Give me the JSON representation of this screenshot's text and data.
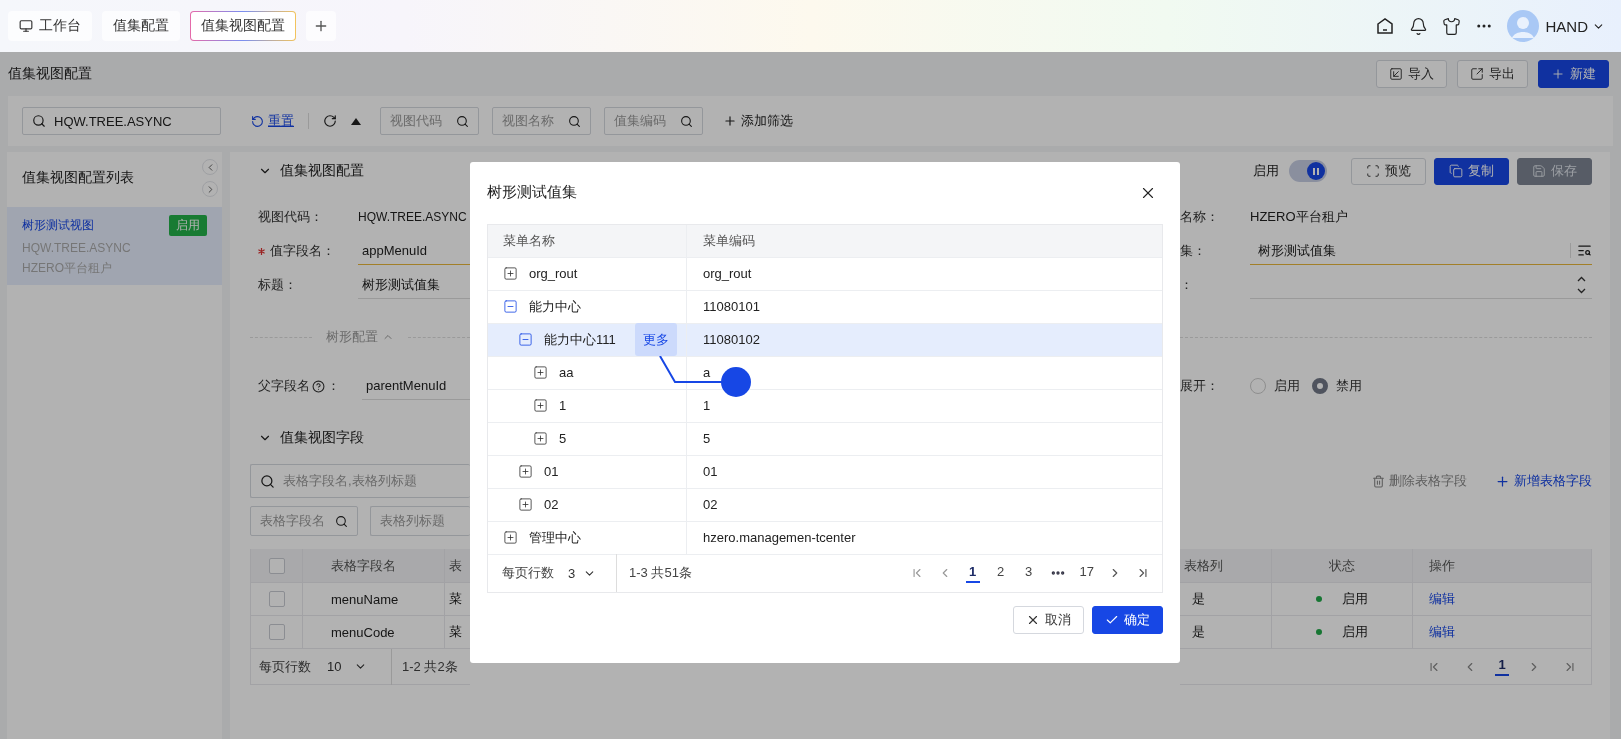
{
  "topbar": {
    "tabs": [
      {
        "label": "工作台",
        "kind": "home",
        "selected": false
      },
      {
        "label": "值集配置",
        "kind": "plain",
        "selected": false
      },
      {
        "label": "值集视图配置",
        "kind": "plain",
        "selected": true
      }
    ],
    "user": "HAND"
  },
  "page": {
    "title": "值集视图配置",
    "actions": [
      {
        "label": "导入",
        "kind": "import"
      },
      {
        "label": "导出",
        "kind": "export"
      },
      {
        "label": "新建",
        "kind": "create"
      }
    ]
  },
  "filter": {
    "search_value": "HQW.TREE.ASYNC",
    "reset": "重置",
    "fields": [
      {
        "placeholder": "视图代码"
      },
      {
        "placeholder": "视图名称"
      },
      {
        "placeholder": "值集编码"
      }
    ],
    "add_filter": "添加筛选"
  },
  "sidebar": {
    "title": "值集视图配置列表",
    "items": [
      {
        "name": "树形测试视图",
        "tag": "启用",
        "code": "HQW.TREE.ASYNC",
        "tenant": "HZERO平台租户",
        "selected": true
      }
    ]
  },
  "detail": {
    "section_title": "值集视图配置",
    "enabled_label": "启用",
    "enabled_on": true,
    "buttons": [
      {
        "label": "预览",
        "kind": "preview"
      },
      {
        "label": "复制",
        "kind": "copy"
      },
      {
        "label": "保存",
        "kind": "save",
        "disabled": true
      }
    ],
    "left_fields": [
      {
        "label": "视图代码：",
        "value": "HQW.TREE.ASYNC",
        "kind": "text"
      },
      {
        "label": "值字段名：",
        "value": "appMenuId",
        "kind": "input",
        "required": true
      },
      {
        "label": "标题：",
        "value": "树形测试值集",
        "kind": "input",
        "required": false
      }
    ],
    "right_fields": [
      {
        "label": "名称：",
        "value": "HZERO平台租户",
        "kind": "text"
      },
      {
        "label": "集：",
        "value": "树形测试值集",
        "kind": "lookup",
        "required": true
      },
      {
        "label": "：",
        "kind": "number",
        "required": false
      }
    ],
    "tree_divider": "树形配置",
    "parent_field": {
      "label": "父字段名",
      "colon": "：",
      "value": "parentMenuId"
    },
    "expand": {
      "label": "展开：",
      "options": [
        {
          "label": "启用",
          "selected": false
        },
        {
          "label": "禁用",
          "selected": true
        }
      ]
    }
  },
  "fields_section": {
    "title": "值集视图字段",
    "search_placeholder": "表格字段名,表格列标题",
    "filters": [
      {
        "placeholder": "表格字段名"
      },
      {
        "placeholder": "表格列标题"
      }
    ],
    "select_all_checked": false,
    "delete_label": "删除表格字段",
    "add_label": "新增表格字段",
    "columns_left": [
      "表格字段名",
      "表"
    ],
    "columns_right": [
      "表格列",
      "状态",
      "操作"
    ],
    "rows": [
      {
        "checked": false,
        "name": "menuName",
        "cut": "菜",
        "table_col": "是",
        "status": "启用",
        "action": "编辑"
      },
      {
        "checked": false,
        "name": "menuCode",
        "cut": "菜",
        "table_col": "是",
        "status": "启用",
        "action": "编辑"
      }
    ],
    "pagination": {
      "page_size_label": "每页行数",
      "page_size": "10",
      "range": "1-2  共2条",
      "pages": [
        {
          "label": "1",
          "selected": true
        }
      ]
    }
  },
  "modal": {
    "title": "树形测试值集",
    "columns": [
      "菜单名称",
      "菜单编码"
    ],
    "tree": [
      {
        "name": "org_rout",
        "code": "org_rout",
        "expanded": false,
        "selected": false
      },
      {
        "name": "能力中心",
        "code": "11080101",
        "expanded": true,
        "selected": false,
        "children": [
          {
            "name": "能力中心111",
            "code": "11080102",
            "expanded": true,
            "selected": true,
            "action": "更多",
            "children": [
              {
                "name": "aa",
                "code": "a",
                "expanded": false,
                "selected": false
              },
              {
                "name": "1",
                "code": "1",
                "expanded": false,
                "selected": false
              },
              {
                "name": "5",
                "code": "5",
                "expanded": false,
                "selected": false
              }
            ]
          },
          {
            "name": "01",
            "code": "01",
            "expanded": false,
            "selected": false
          },
          {
            "name": "02",
            "code": "02",
            "expanded": false,
            "selected": false
          }
        ]
      },
      {
        "name": "管理中心",
        "code": "hzero.managemen-tcenter",
        "expanded": false,
        "selected": false
      }
    ],
    "pagination": {
      "page_size_label": "每页行数",
      "page_size": "3",
      "range": "1-3  共51条",
      "pages": [
        {
          "kind": "page",
          "label": "1",
          "selected": true
        },
        {
          "kind": "page",
          "label": "2",
          "selected": false
        },
        {
          "kind": "page",
          "label": "3",
          "selected": false
        },
        {
          "kind": "ellipsis"
        },
        {
          "kind": "page",
          "label": "17",
          "selected": false
        }
      ]
    },
    "cancel": "取消",
    "ok": "确定"
  }
}
